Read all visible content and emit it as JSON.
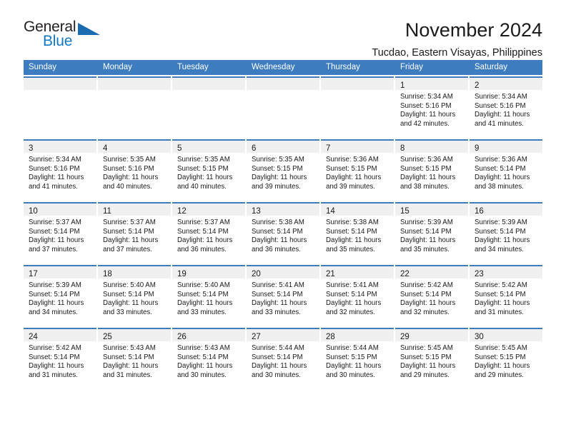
{
  "brand": {
    "name_top": "General",
    "name_bottom": "Blue",
    "triangle_icon": "triangle-icon",
    "color_top": "#231f20",
    "color_bottom": "#1277c4",
    "triangle_color": "#1a6bb0"
  },
  "header": {
    "title": "November 2024",
    "subtitle": "Tucdao, Eastern Visayas, Philippines"
  },
  "theme": {
    "header_blue": "#3c7cbf",
    "daynum_band": "#f0f0f0",
    "text": "#1a1a1a"
  },
  "weekdays": [
    "Sunday",
    "Monday",
    "Tuesday",
    "Wednesday",
    "Thursday",
    "Friday",
    "Saturday"
  ],
  "labels": {
    "sunrise": "Sunrise:",
    "sunset": "Sunset:",
    "daylight": "Daylight:"
  },
  "weeks": [
    [
      {
        "day": "",
        "sunrise": "",
        "sunset": "",
        "daylight": "",
        "empty": true
      },
      {
        "day": "",
        "sunrise": "",
        "sunset": "",
        "daylight": "",
        "empty": true
      },
      {
        "day": "",
        "sunrise": "",
        "sunset": "",
        "daylight": "",
        "empty": true
      },
      {
        "day": "",
        "sunrise": "",
        "sunset": "",
        "daylight": "",
        "empty": true
      },
      {
        "day": "",
        "sunrise": "",
        "sunset": "",
        "daylight": "",
        "empty": true
      },
      {
        "day": "1",
        "sunrise": "Sunrise: 5:34 AM",
        "sunset": "Sunset: 5:16 PM",
        "daylight": "Daylight: 11 hours and 42 minutes."
      },
      {
        "day": "2",
        "sunrise": "Sunrise: 5:34 AM",
        "sunset": "Sunset: 5:16 PM",
        "daylight": "Daylight: 11 hours and 41 minutes."
      }
    ],
    [
      {
        "day": "3",
        "sunrise": "Sunrise: 5:34 AM",
        "sunset": "Sunset: 5:16 PM",
        "daylight": "Daylight: 11 hours and 41 minutes."
      },
      {
        "day": "4",
        "sunrise": "Sunrise: 5:35 AM",
        "sunset": "Sunset: 5:16 PM",
        "daylight": "Daylight: 11 hours and 40 minutes."
      },
      {
        "day": "5",
        "sunrise": "Sunrise: 5:35 AM",
        "sunset": "Sunset: 5:15 PM",
        "daylight": "Daylight: 11 hours and 40 minutes."
      },
      {
        "day": "6",
        "sunrise": "Sunrise: 5:35 AM",
        "sunset": "Sunset: 5:15 PM",
        "daylight": "Daylight: 11 hours and 39 minutes."
      },
      {
        "day": "7",
        "sunrise": "Sunrise: 5:36 AM",
        "sunset": "Sunset: 5:15 PM",
        "daylight": "Daylight: 11 hours and 39 minutes."
      },
      {
        "day": "8",
        "sunrise": "Sunrise: 5:36 AM",
        "sunset": "Sunset: 5:15 PM",
        "daylight": "Daylight: 11 hours and 38 minutes."
      },
      {
        "day": "9",
        "sunrise": "Sunrise: 5:36 AM",
        "sunset": "Sunset: 5:14 PM",
        "daylight": "Daylight: 11 hours and 38 minutes."
      }
    ],
    [
      {
        "day": "10",
        "sunrise": "Sunrise: 5:37 AM",
        "sunset": "Sunset: 5:14 PM",
        "daylight": "Daylight: 11 hours and 37 minutes."
      },
      {
        "day": "11",
        "sunrise": "Sunrise: 5:37 AM",
        "sunset": "Sunset: 5:14 PM",
        "daylight": "Daylight: 11 hours and 37 minutes."
      },
      {
        "day": "12",
        "sunrise": "Sunrise: 5:37 AM",
        "sunset": "Sunset: 5:14 PM",
        "daylight": "Daylight: 11 hours and 36 minutes."
      },
      {
        "day": "13",
        "sunrise": "Sunrise: 5:38 AM",
        "sunset": "Sunset: 5:14 PM",
        "daylight": "Daylight: 11 hours and 36 minutes."
      },
      {
        "day": "14",
        "sunrise": "Sunrise: 5:38 AM",
        "sunset": "Sunset: 5:14 PM",
        "daylight": "Daylight: 11 hours and 35 minutes."
      },
      {
        "day": "15",
        "sunrise": "Sunrise: 5:39 AM",
        "sunset": "Sunset: 5:14 PM",
        "daylight": "Daylight: 11 hours and 35 minutes."
      },
      {
        "day": "16",
        "sunrise": "Sunrise: 5:39 AM",
        "sunset": "Sunset: 5:14 PM",
        "daylight": "Daylight: 11 hours and 34 minutes."
      }
    ],
    [
      {
        "day": "17",
        "sunrise": "Sunrise: 5:39 AM",
        "sunset": "Sunset: 5:14 PM",
        "daylight": "Daylight: 11 hours and 34 minutes."
      },
      {
        "day": "18",
        "sunrise": "Sunrise: 5:40 AM",
        "sunset": "Sunset: 5:14 PM",
        "daylight": "Daylight: 11 hours and 33 minutes."
      },
      {
        "day": "19",
        "sunrise": "Sunrise: 5:40 AM",
        "sunset": "Sunset: 5:14 PM",
        "daylight": "Daylight: 11 hours and 33 minutes."
      },
      {
        "day": "20",
        "sunrise": "Sunrise: 5:41 AM",
        "sunset": "Sunset: 5:14 PM",
        "daylight": "Daylight: 11 hours and 33 minutes."
      },
      {
        "day": "21",
        "sunrise": "Sunrise: 5:41 AM",
        "sunset": "Sunset: 5:14 PM",
        "daylight": "Daylight: 11 hours and 32 minutes."
      },
      {
        "day": "22",
        "sunrise": "Sunrise: 5:42 AM",
        "sunset": "Sunset: 5:14 PM",
        "daylight": "Daylight: 11 hours and 32 minutes."
      },
      {
        "day": "23",
        "sunrise": "Sunrise: 5:42 AM",
        "sunset": "Sunset: 5:14 PM",
        "daylight": "Daylight: 11 hours and 31 minutes."
      }
    ],
    [
      {
        "day": "24",
        "sunrise": "Sunrise: 5:42 AM",
        "sunset": "Sunset: 5:14 PM",
        "daylight": "Daylight: 11 hours and 31 minutes."
      },
      {
        "day": "25",
        "sunrise": "Sunrise: 5:43 AM",
        "sunset": "Sunset: 5:14 PM",
        "daylight": "Daylight: 11 hours and 31 minutes."
      },
      {
        "day": "26",
        "sunrise": "Sunrise: 5:43 AM",
        "sunset": "Sunset: 5:14 PM",
        "daylight": "Daylight: 11 hours and 30 minutes."
      },
      {
        "day": "27",
        "sunrise": "Sunrise: 5:44 AM",
        "sunset": "Sunset: 5:14 PM",
        "daylight": "Daylight: 11 hours and 30 minutes."
      },
      {
        "day": "28",
        "sunrise": "Sunrise: 5:44 AM",
        "sunset": "Sunset: 5:15 PM",
        "daylight": "Daylight: 11 hours and 30 minutes."
      },
      {
        "day": "29",
        "sunrise": "Sunrise: 5:45 AM",
        "sunset": "Sunset: 5:15 PM",
        "daylight": "Daylight: 11 hours and 29 minutes."
      },
      {
        "day": "30",
        "sunrise": "Sunrise: 5:45 AM",
        "sunset": "Sunset: 5:15 PM",
        "daylight": "Daylight: 11 hours and 29 minutes."
      }
    ]
  ]
}
